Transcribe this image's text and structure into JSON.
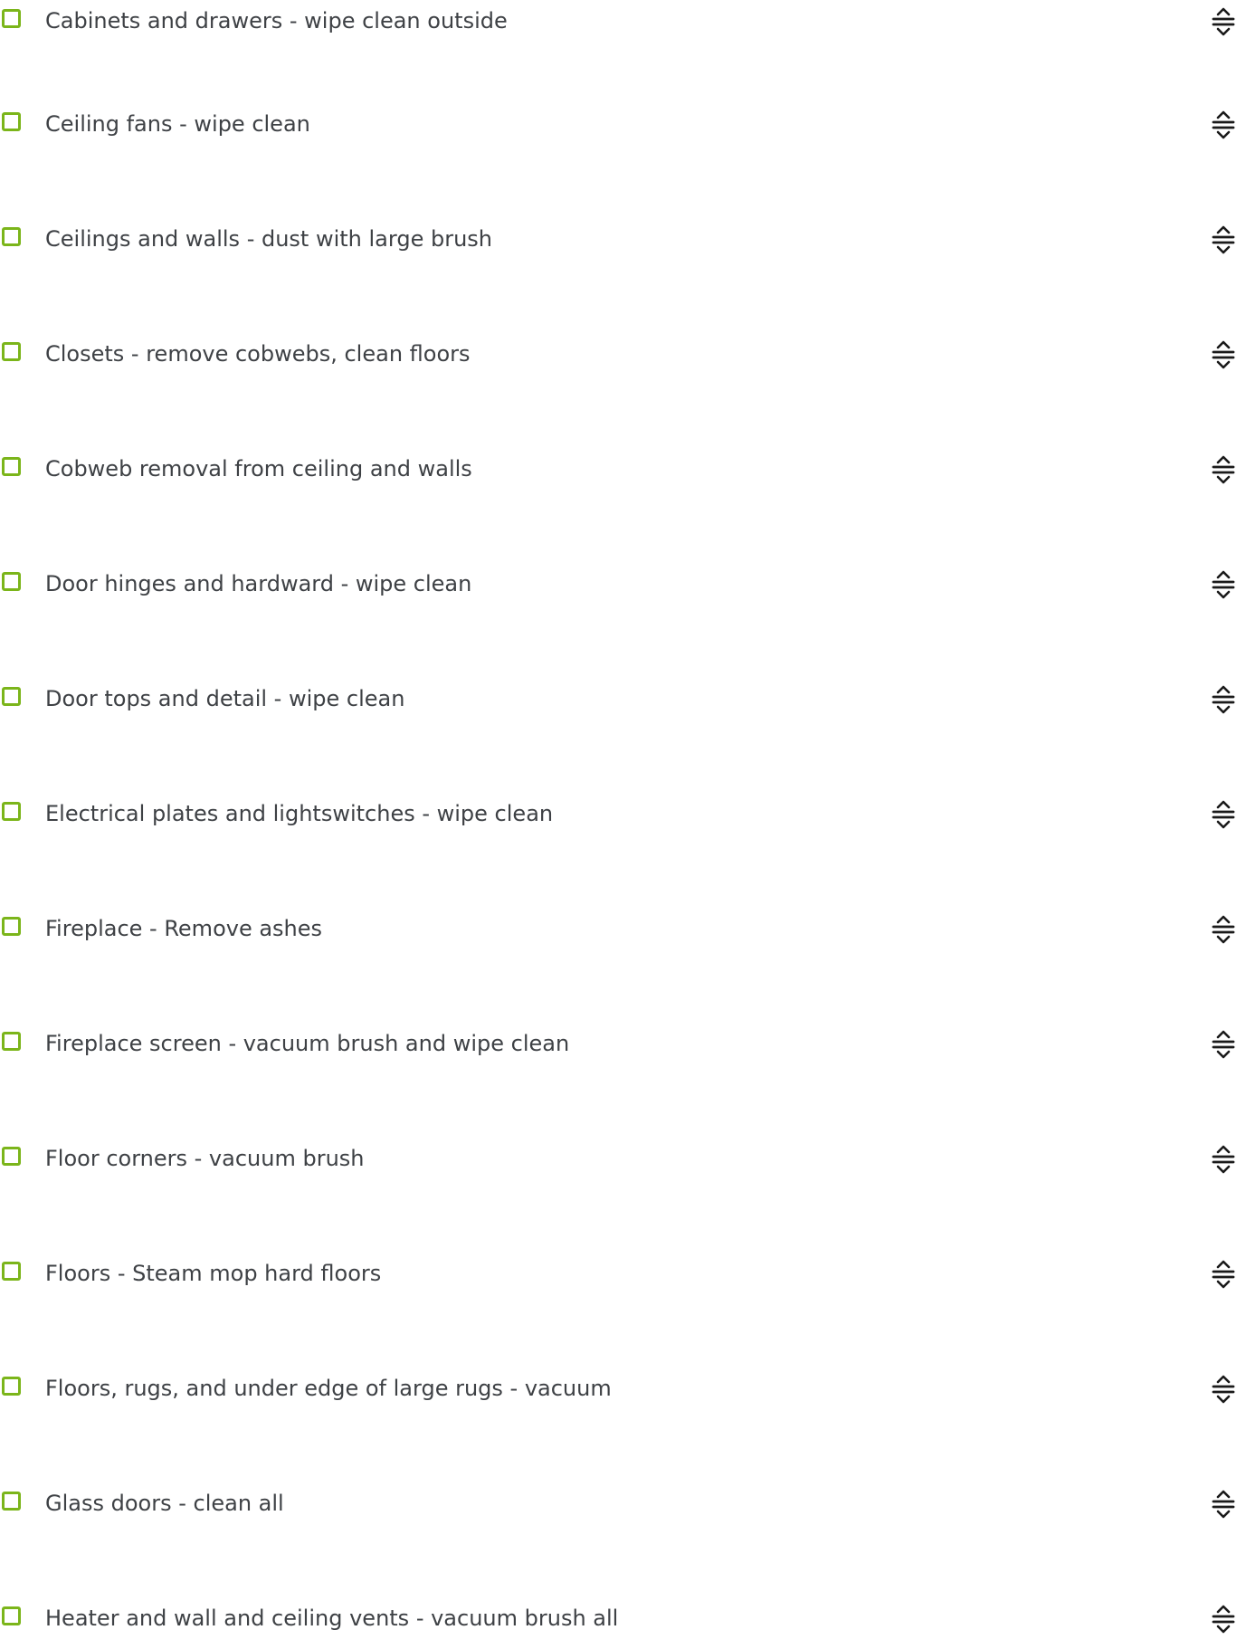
{
  "colors": {
    "checkbox_border": "#7bb51a",
    "label_text": "#3e4145",
    "handle": "#1a1a1a"
  },
  "icons": {
    "checkbox": "checkbox-unchecked-icon",
    "handle": "drag-handle-icon"
  },
  "checklist": {
    "items": [
      {
        "label": "Cabinets and drawers - wipe clean outside",
        "checked": false
      },
      {
        "label": "Ceiling fans - wipe clean",
        "checked": false
      },
      {
        "label": "Ceilings and walls - dust with large brush",
        "checked": false
      },
      {
        "label": "Closets - remove cobwebs, clean floors",
        "checked": false
      },
      {
        "label": "Cobweb removal from ceiling and walls",
        "checked": false
      },
      {
        "label": "Door hinges and hardward - wipe clean",
        "checked": false
      },
      {
        "label": "Door tops and detail - wipe clean",
        "checked": false
      },
      {
        "label": "Electrical plates and lightswitches - wipe clean",
        "checked": false
      },
      {
        "label": "Fireplace - Remove ashes",
        "checked": false
      },
      {
        "label": "Fireplace screen - vacuum brush and wipe clean",
        "checked": false
      },
      {
        "label": "Floor corners - vacuum brush",
        "checked": false
      },
      {
        "label": "Floors - Steam mop hard floors",
        "checked": false
      },
      {
        "label": "Floors, rugs, and under edge of large rugs - vacuum",
        "checked": false
      },
      {
        "label": "Glass doors - clean all",
        "checked": false
      },
      {
        "label": "Heater and wall and ceiling vents - vacuum brush all",
        "checked": false
      }
    ]
  }
}
